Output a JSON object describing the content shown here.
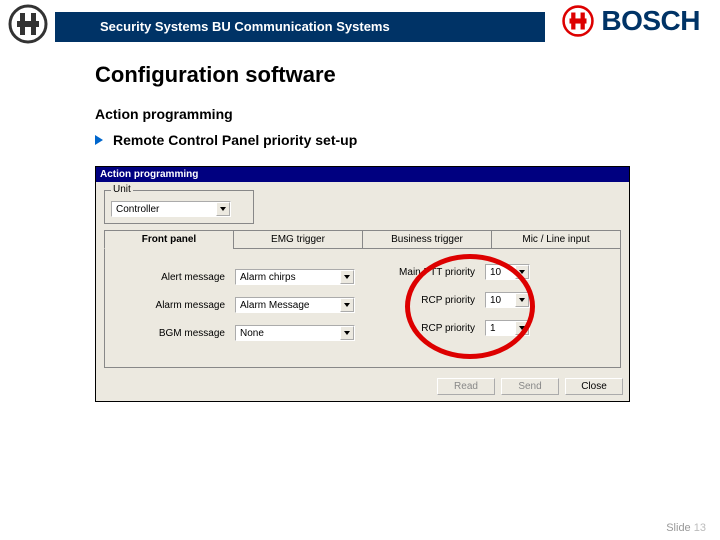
{
  "header": {
    "blue_bar": "Security Systems BU Communication Systems",
    "brand": "BOSCH"
  },
  "page": {
    "title": "Configuration software",
    "section": "Action programming",
    "bullet": "Remote Control Panel priority set-up"
  },
  "dialog": {
    "title": "Action programming",
    "unit_label": "Unit",
    "unit_value": "Controller",
    "tabs": [
      "Front panel",
      "EMG trigger",
      "Business trigger",
      "Mic / Line input"
    ],
    "rows": [
      {
        "label": "Alert message",
        "value": "Alarm chirps"
      },
      {
        "label": "Alarm message",
        "value": "Alarm Message"
      },
      {
        "label": "BGM message",
        "value": "None"
      }
    ],
    "priority_rows": [
      {
        "label": "Main PTT priority",
        "value": "10"
      },
      {
        "label": "RCP priority",
        "value": "10"
      },
      {
        "label": "RCP priority",
        "value": "1"
      }
    ],
    "buttons": [
      "Read",
      "Send",
      "Close"
    ]
  },
  "footer": {
    "label": "Slide",
    "num": "13"
  }
}
